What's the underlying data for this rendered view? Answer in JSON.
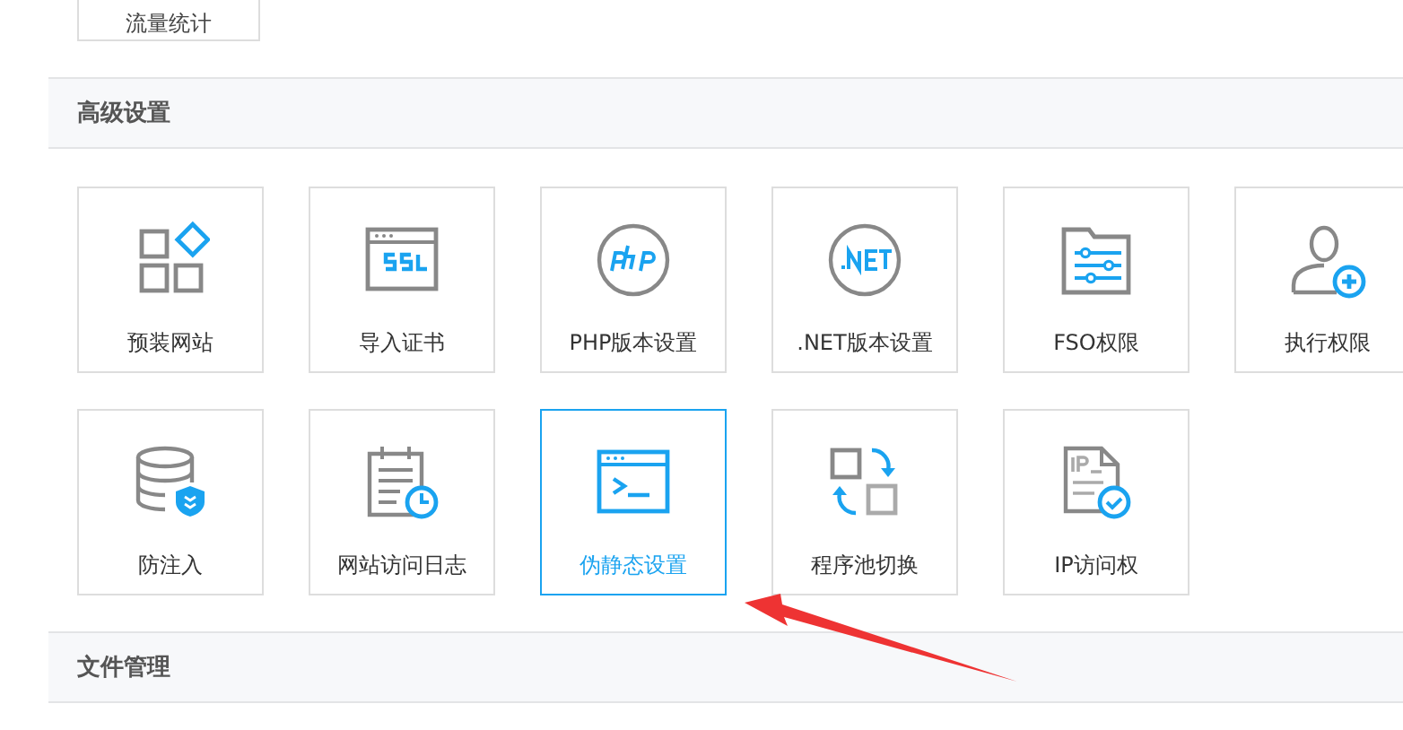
{
  "top_tile": {
    "label": "流量统计"
  },
  "sections": [
    {
      "title": "高级设置",
      "tiles": [
        {
          "label": "预装网站",
          "kind": "apps",
          "selected": false
        },
        {
          "label": "导入证书",
          "kind": "ssl",
          "selected": false
        },
        {
          "label": "PHP版本设置",
          "kind": "php",
          "selected": false
        },
        {
          "label": ".NET版本设置",
          "kind": "net",
          "selected": false
        },
        {
          "label": "FSO权限",
          "kind": "folder",
          "selected": false
        },
        {
          "label": "执行权限",
          "kind": "user",
          "selected": false
        },
        {
          "label": "防注入",
          "kind": "database",
          "selected": false
        },
        {
          "label": "网站访问日志",
          "kind": "log",
          "selected": false
        },
        {
          "label": "伪静态设置",
          "kind": "terminal",
          "selected": true
        },
        {
          "label": "程序池切换",
          "kind": "switch",
          "selected": false
        },
        {
          "label": "IP访问权",
          "kind": "ip",
          "selected": false
        }
      ]
    },
    {
      "title": "文件管理"
    }
  ]
}
